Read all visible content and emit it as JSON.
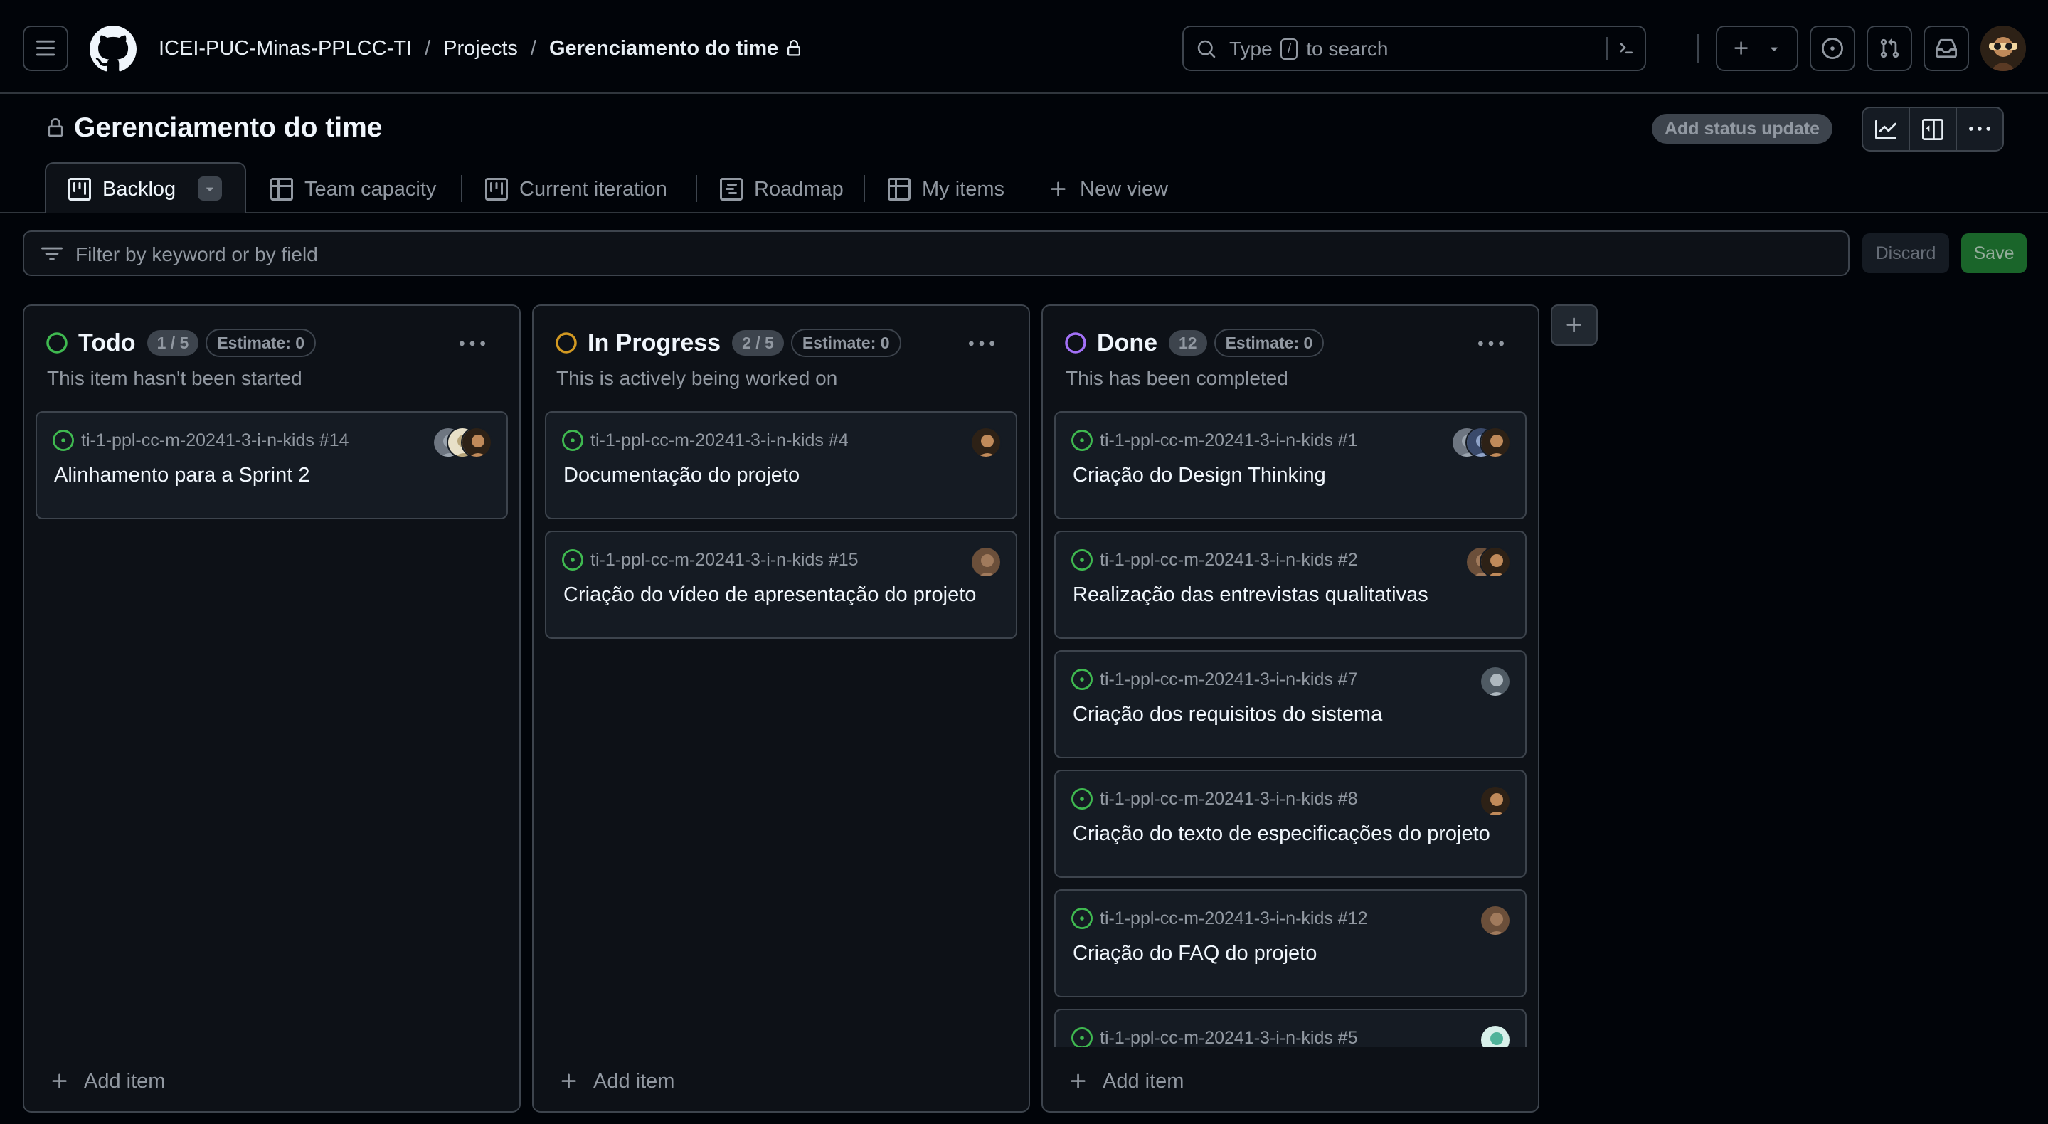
{
  "header": {
    "breadcrumb": {
      "org": "ICEI-PUC-Minas-PPLCC-TI",
      "sep1": "/",
      "projects": "Projects",
      "sep2": "/",
      "current": "Gerenciamento do time"
    },
    "search": {
      "pre": "Type",
      "key": "/",
      "post": "to search"
    }
  },
  "project": {
    "title": "Gerenciamento do time",
    "status_button": "Add status update"
  },
  "tabs": [
    {
      "label": "Backlog",
      "icon": "board-icon",
      "active": true
    },
    {
      "label": "Team capacity",
      "icon": "table-icon"
    },
    {
      "label": "Current iteration",
      "icon": "board-icon"
    },
    {
      "label": "Roadmap",
      "icon": "roadmap-icon"
    },
    {
      "label": "My items",
      "icon": "table-icon"
    },
    {
      "label": "New view",
      "icon": "plus-icon"
    }
  ],
  "filter": {
    "placeholder": "Filter by keyword or by field",
    "discard": "Discard",
    "save": "Save"
  },
  "colors": {
    "todo": "#3fb950",
    "in_progress": "#d29922",
    "done": "#a371f7",
    "open_issue": "#3fb950"
  },
  "columns": [
    {
      "name": "Todo",
      "count": "1 / 5",
      "estimate": "Estimate: 0",
      "description": "This item hasn't been started",
      "status_color": "#3fb950",
      "add_label": "Add item",
      "cards": [
        {
          "repo": "ti-1-ppl-cc-m-20241-3-i-n-kids #14",
          "title": "Alinhamento para a Sprint 2",
          "assignees": [
            "gray",
            "light",
            "dark"
          ]
        }
      ]
    },
    {
      "name": "In Progress",
      "count": "2 / 5",
      "estimate": "Estimate: 0",
      "description": "This is actively being worked on",
      "status_color": "#d29922",
      "add_label": "Add item",
      "cards": [
        {
          "repo": "ti-1-ppl-cc-m-20241-3-i-n-kids #4",
          "title": "Documentação do projeto",
          "assignees": [
            "dark"
          ]
        },
        {
          "repo": "ti-1-ppl-cc-m-20241-3-i-n-kids #15",
          "title": "Criação do vídeo de apresentação do projeto",
          "assignees": [
            "brown"
          ]
        }
      ]
    },
    {
      "name": "Done",
      "count": "12",
      "estimate": "Estimate: 0",
      "description": "This has been completed",
      "status_color": "#a371f7",
      "add_label": "Add item",
      "cards": [
        {
          "repo": "ti-1-ppl-cc-m-20241-3-i-n-kids #1",
          "title": "Criação do Design Thinking",
          "assignees": [
            "gray",
            "blue",
            "dark"
          ]
        },
        {
          "repo": "ti-1-ppl-cc-m-20241-3-i-n-kids #2",
          "title": "Realização das entrevistas qualitativas",
          "assignees": [
            "brown",
            "dark"
          ]
        },
        {
          "repo": "ti-1-ppl-cc-m-20241-3-i-n-kids #7",
          "title": "Criação dos requisitos do sistema",
          "assignees": [
            "slate"
          ]
        },
        {
          "repo": "ti-1-ppl-cc-m-20241-3-i-n-kids #8",
          "title": "Criação do texto de especificações do projeto",
          "assignees": [
            "dark"
          ]
        },
        {
          "repo": "ti-1-ppl-cc-m-20241-3-i-n-kids #12",
          "title": "Criação do FAQ do projeto",
          "assignees": [
            "brown"
          ]
        },
        {
          "repo": "ti-1-ppl-cc-m-20241-3-i-n-kids #5",
          "title": "",
          "assignees": [
            "mint"
          ]
        }
      ]
    }
  ]
}
